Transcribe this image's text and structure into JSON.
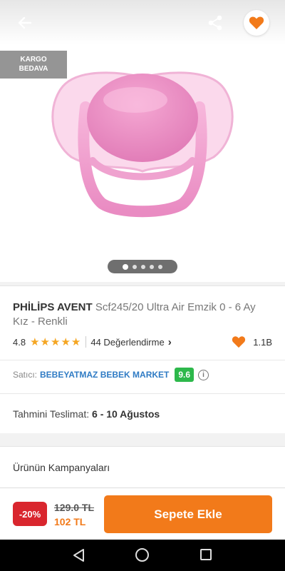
{
  "badge": {
    "line1": "KARGO",
    "line2": "BEDAVA"
  },
  "gallery": {
    "dot_count": 5,
    "active_index": 0
  },
  "product": {
    "brand": "PHİLİPS AVENT",
    "name": "Scf245/20 Ultra Air Emzik 0 - 6 Ay Kız - Renkli",
    "rating": "4.8",
    "stars": 5,
    "reviews": "44 Değerlendirme",
    "likes": "1.1B"
  },
  "seller": {
    "label": "Satıcı:",
    "name": "BEBEYATMAZ BEBEK MARKET",
    "score": "9.6"
  },
  "delivery": {
    "label": "Tahmini Teslimat:",
    "value": "6 - 10 Ağustos"
  },
  "campaign": {
    "title": "Ürünün Kampanyaları"
  },
  "cart": {
    "discount": "-20%",
    "old_price": "129.0 TL",
    "new_price": "102 TL",
    "button": "Sepete Ekle"
  },
  "colors": {
    "accent": "#f27a1a",
    "seller_link": "#2f7bc4",
    "score_bg": "#2db84b",
    "discount_bg": "#d9262e"
  },
  "icons": {
    "back": "arrow-left-icon",
    "share": "share-icon",
    "favorite": "heart-icon",
    "info": "info-icon"
  }
}
